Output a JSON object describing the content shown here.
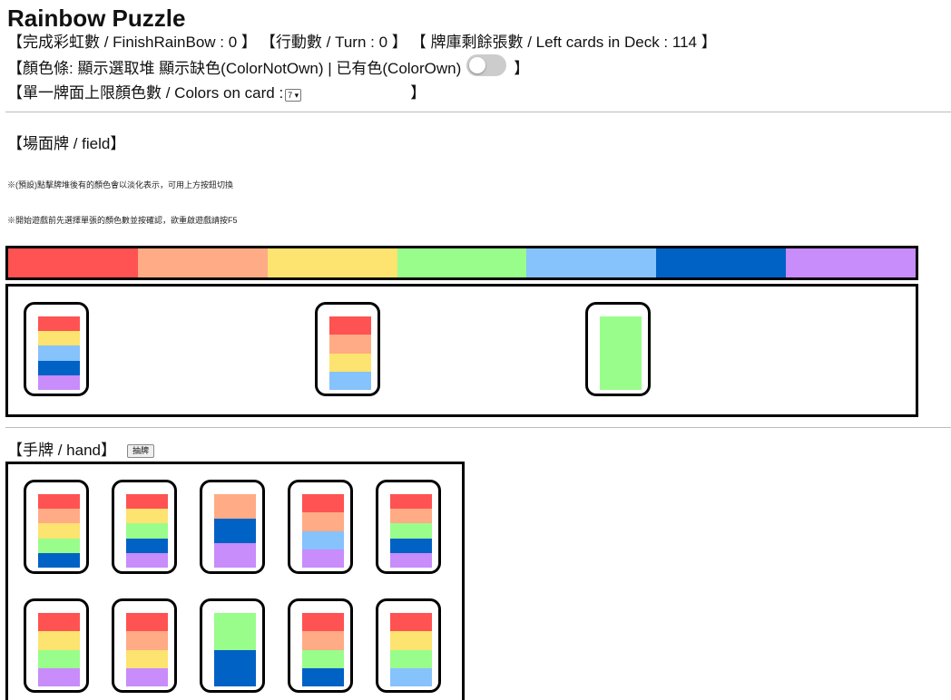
{
  "app": {
    "title": "Rainbow Puzzle"
  },
  "status": {
    "finish_rainbow": "【完成彩虹數 / FinishRainBow : 0 】",
    "turn": "【行動數 / Turn : 0 】",
    "deck_left": "【 牌庫剩餘張數 / Left cards in Deck : 114 】"
  },
  "color_bar_option": {
    "label": "【顏色條: 顯示選取堆 顯示缺色(ColorNotOwn) | 已有色(ColorOwn)",
    "close": "】",
    "toggle_on": false
  },
  "colors_per_card": {
    "label": "【單一牌面上限顏色數 / Colors on card :",
    "selected": "7 ▾",
    "close": "】"
  },
  "field": {
    "label": "【場面牌 / field】",
    "note1": "※(預設)點擊牌堆後有的顏色會以淡化表示，可用上方按鈕切換",
    "note2": "※開始遊戲前先選擇單張的顏色數並按確認，欲重啟遊戲請按F5"
  },
  "hand": {
    "label": "【手牌 / hand】",
    "draw_button": "抽牌"
  },
  "palette": {
    "red": "#ff5252",
    "peach": "#ffab85",
    "yellow": "#fde36f",
    "green": "#99fd8b",
    "skyblue": "#86c2fc",
    "blue": "#0062c5",
    "purple": "#c88cfb"
  },
  "rainbow_bar": [
    "red",
    "peach",
    "yellow",
    "green",
    "skyblue",
    "blue",
    "purple"
  ],
  "field_cards": [
    [
      "red",
      "yellow",
      "skyblue",
      "blue",
      "purple"
    ],
    [
      "red",
      "peach",
      "yellow",
      "skyblue"
    ],
    [
      "green"
    ]
  ],
  "hand_cards": [
    [
      "red",
      "peach",
      "yellow",
      "green",
      "blue"
    ],
    [
      "red",
      "yellow",
      "green",
      "blue",
      "purple"
    ],
    [
      "peach",
      "blue",
      "purple"
    ],
    [
      "red",
      "peach",
      "skyblue",
      "purple"
    ],
    [
      "red",
      "peach",
      "green",
      "blue",
      "purple"
    ],
    [
      "red",
      "yellow",
      "green",
      "purple"
    ],
    [
      "red",
      "peach",
      "yellow",
      "purple"
    ],
    [
      "green",
      "blue"
    ],
    [
      "red",
      "peach",
      "green",
      "blue"
    ],
    [
      "red",
      "yellow",
      "green",
      "skyblue"
    ]
  ]
}
